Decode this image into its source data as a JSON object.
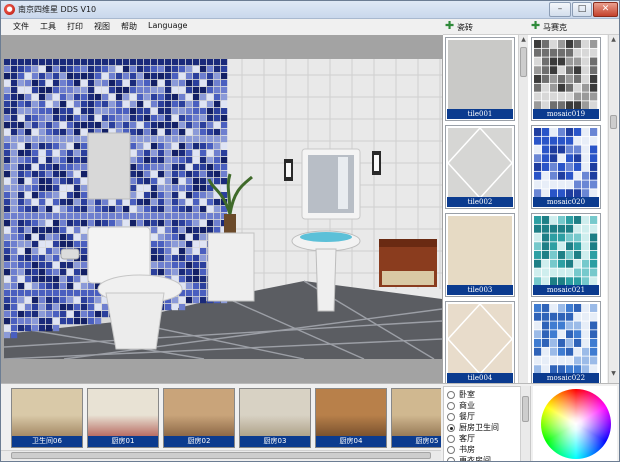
{
  "window": {
    "title": "南京四维星 DDS V10",
    "controls": {
      "minimize": "–",
      "maximize": "□",
      "close": "✕"
    }
  },
  "menu": [
    "文件",
    "工具",
    "打印",
    "视图",
    "帮助",
    "Language"
  ],
  "panels": {
    "ceramic": {
      "label": "瓷砖"
    },
    "mosaic": {
      "label": "马赛克"
    }
  },
  "ceramic_tiles": [
    {
      "name": "tile001",
      "color": "#c9c9c7",
      "pattern": "plain"
    },
    {
      "name": "tile002",
      "color": "#d6d6d4",
      "pattern": "diamond"
    },
    {
      "name": "tile003",
      "color": "#e6dac4",
      "pattern": "plain"
    },
    {
      "name": "tile004",
      "color": "#e8dccb",
      "pattern": "diamond"
    }
  ],
  "mosaic_tiles": [
    {
      "name": "mosaic019",
      "colors": [
        "#3b3b3b",
        "#9a9a9a",
        "#d8d8d8",
        "#6f6f6f"
      ]
    },
    {
      "name": "mosaic020",
      "colors": [
        "#1f3ea0",
        "#6a86d4",
        "#e8eef8",
        "#2a55c8"
      ]
    },
    {
      "name": "mosaic021",
      "colors": [
        "#2d9fa3",
        "#76c9cc",
        "#cfeeee",
        "#1e7f86"
      ]
    },
    {
      "name": "mosaic022",
      "colors": [
        "#3f7cd1",
        "#9bbbe8",
        "#e7eef8",
        "#2f63b8"
      ]
    }
  ],
  "room_thumbnails": [
    {
      "label": "卫生间06",
      "top": "#d9c9a8",
      "bottom": "#8a6a44"
    },
    {
      "label": "厨房01",
      "top": "#e8e2d4",
      "bottom": "#a0302a"
    },
    {
      "label": "厨房02",
      "top": "#c9a47a",
      "bottom": "#6e4a2c"
    },
    {
      "label": "厨房03",
      "top": "#d8d2c4",
      "bottom": "#9a8a6c"
    },
    {
      "label": "厨房04",
      "top": "#b8804a",
      "bottom": "#5a3a20"
    },
    {
      "label": "厨房05",
      "top": "#d0b890",
      "bottom": "#7a5a3a"
    }
  ],
  "categories": [
    {
      "label": "卧室",
      "selected": false
    },
    {
      "label": "商业",
      "selected": false
    },
    {
      "label": "餐厅",
      "selected": false
    },
    {
      "label": "厨房卫生间",
      "selected": true
    },
    {
      "label": "客厅",
      "selected": false
    },
    {
      "label": "书房",
      "selected": false
    },
    {
      "label": "更衣房间",
      "selected": false
    }
  ],
  "scene": {
    "mosaic_wall_colors": [
      "#1a2a7a",
      "#2b3f9c",
      "#4a5fbf",
      "#8b9ad8",
      "#dfe4f4",
      "#132066",
      "#6e7fcf"
    ]
  }
}
